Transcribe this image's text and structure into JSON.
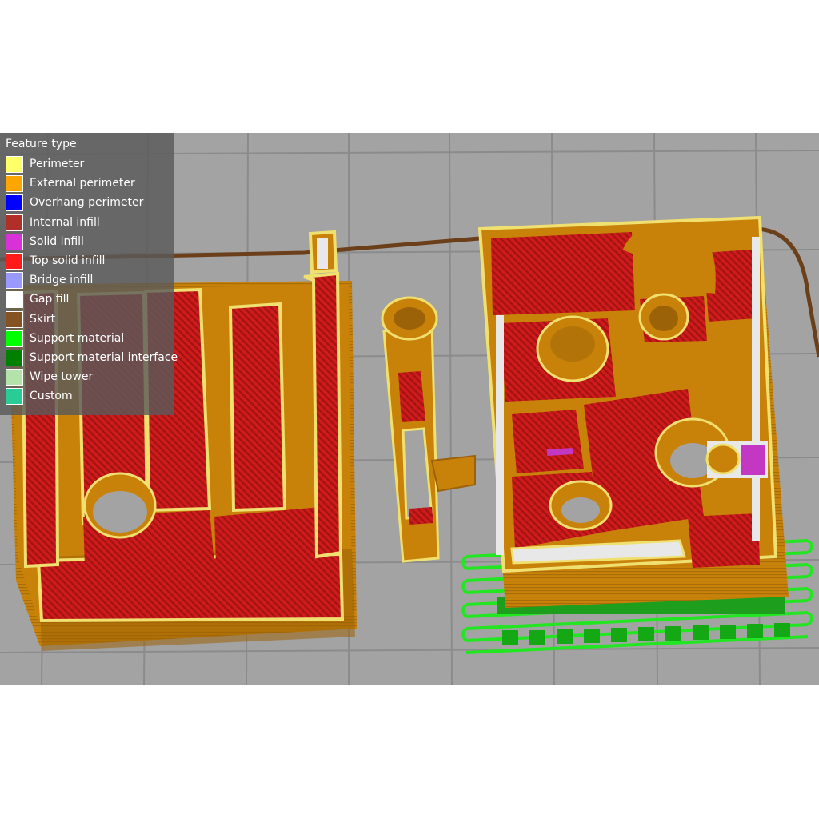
{
  "legend": {
    "title": "Feature type",
    "items": [
      {
        "label": "Perimeter",
        "color": "#ffff68"
      },
      {
        "label": "External perimeter",
        "color": "#ffa500"
      },
      {
        "label": "Overhang perimeter",
        "color": "#0000ff"
      },
      {
        "label": "Internal infill",
        "color": "#b03029"
      },
      {
        "label": "Solid infill",
        "color": "#d732d7"
      },
      {
        "label": "Top solid infill",
        "color": "#ff1a1a"
      },
      {
        "label": "Bridge infill",
        "color": "#9999ff"
      },
      {
        "label": "Gap fill",
        "color": "#ffffff"
      },
      {
        "label": "Skirt",
        "color": "#845321"
      },
      {
        "label": "Support material",
        "color": "#00ff00"
      },
      {
        "label": "Support material interface",
        "color": "#008000"
      },
      {
        "label": "Wipe tower",
        "color": "#b3e3ab"
      },
      {
        "label": "Custom",
        "color": "#28cc94"
      }
    ]
  },
  "scene_colors": {
    "bed": "#a3a3a3",
    "grid": "#8b8b8b",
    "wall": "#c8820a",
    "wall_dark": "#9c6208",
    "rim": "#f0e070",
    "infill": "#cf1b1b",
    "infill_stripe": "#a31313",
    "gap": "#e8e8e8",
    "support": "#22e622",
    "support_dark": "#15a815",
    "skirt": "#6b3f1a"
  }
}
